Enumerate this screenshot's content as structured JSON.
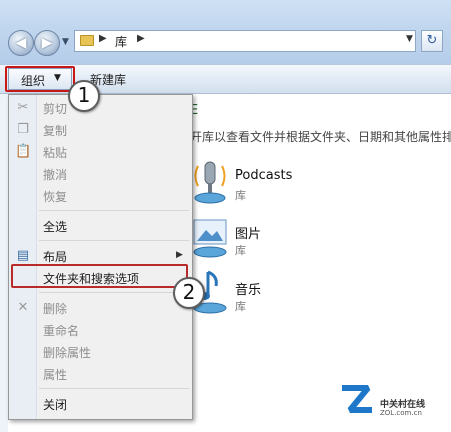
{
  "address": {
    "location": "库"
  },
  "toolbar": {
    "organize_label": "组织",
    "new_library_label": "新建库"
  },
  "library": {
    "heading_fragment": "E",
    "description_fragment": "开库以查看文件并根据文件夹、日期和其他属性排",
    "items": [
      {
        "name": "Podcasts",
        "type": "库"
      },
      {
        "name": "图片",
        "type": "库"
      },
      {
        "name": "音乐",
        "type": "库"
      }
    ]
  },
  "menu": {
    "items": [
      {
        "label": "剪切",
        "icon": "scissors-icon",
        "enabled": false
      },
      {
        "label": "复制",
        "icon": "copy-icon",
        "enabled": false
      },
      {
        "label": "粘贴",
        "icon": "paste-icon",
        "enabled": false
      },
      {
        "label": "撤消",
        "enabled": false
      },
      {
        "label": "恢复",
        "enabled": false
      },
      {
        "label": "全选",
        "enabled": true
      },
      {
        "label": "布局",
        "icon": "layout-icon",
        "enabled": true,
        "submenu": true
      },
      {
        "label": "文件夹和搜索选项",
        "enabled": true,
        "highlighted": true
      },
      {
        "label": "删除",
        "icon": "delete-icon",
        "enabled": false
      },
      {
        "label": "重命名",
        "enabled": false
      },
      {
        "label": "删除属性",
        "enabled": false
      },
      {
        "label": "属性",
        "enabled": false
      },
      {
        "label": "关闭",
        "enabled": true
      }
    ]
  },
  "callouts": {
    "one": "1",
    "two": "2"
  },
  "watermark": {
    "title": "中关村在线",
    "domain": "ZOL.com.cn"
  },
  "colors": {
    "highlight_border": "#c81717",
    "menu_bg": "#f0f0f0",
    "toolbar_bg": "#dce6f2"
  }
}
